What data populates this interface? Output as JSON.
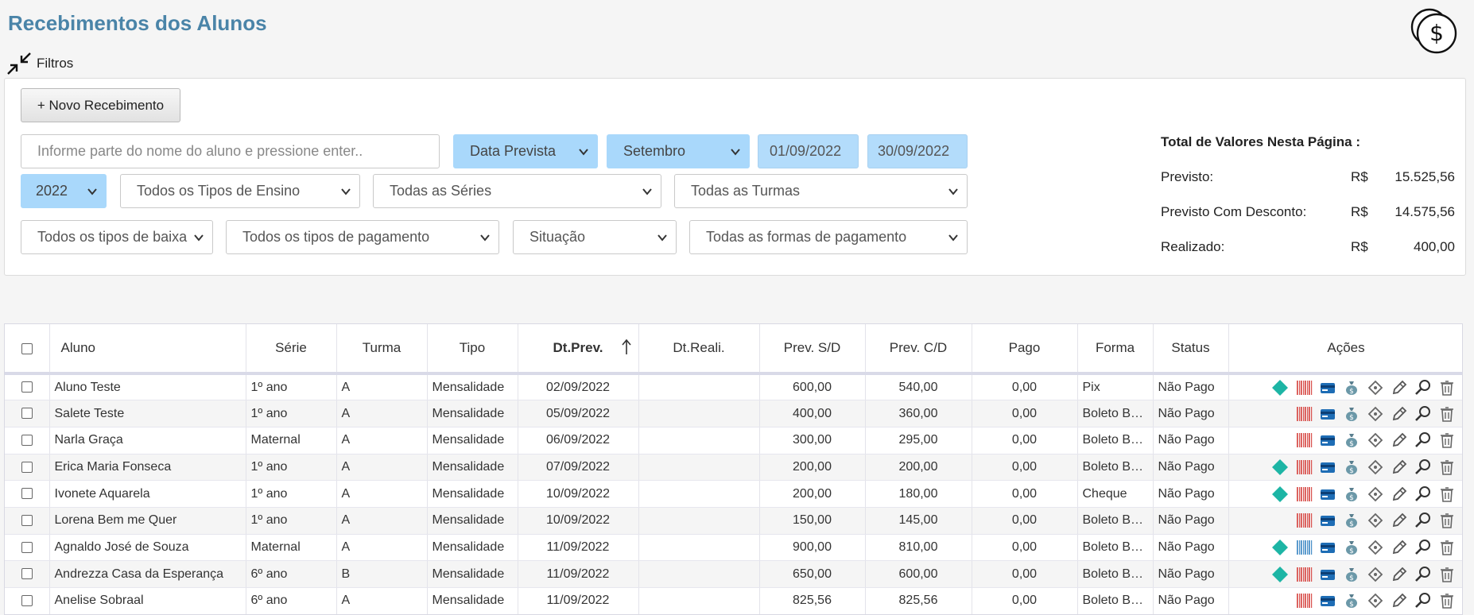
{
  "header": {
    "title": "Recebimentos dos Alunos"
  },
  "filters": {
    "toggle_label": "Filtros",
    "new_button": "+ Novo Recebimento",
    "search_placeholder": "Informe parte do nome do aluno e pressione enter..",
    "date_type": "Data Prevista",
    "month": "Setembro",
    "date_from": "01/09/2022",
    "date_to": "30/09/2022",
    "year": "2022",
    "teaching_type": "Todos os Tipos de Ensino",
    "series": "Todas as Séries",
    "classes": "Todas as Turmas",
    "write_off_type": "Todos os tipos de baixa",
    "payment_type": "Todos os tipos de pagamento",
    "situation": "Situação",
    "payment_form": "Todas as formas de pagamento"
  },
  "totals": {
    "title": "Total de Valores Nesta Página :",
    "currency": "R$",
    "rows": [
      {
        "label": "Previsto:",
        "value": "15.525,56"
      },
      {
        "label": "Previsto Com Desconto:",
        "value": "14.575,56"
      },
      {
        "label": "Realizado:",
        "value": "400,00"
      }
    ]
  },
  "table": {
    "columns": [
      "Aluno",
      "Série",
      "Turma",
      "Tipo",
      "Dt.Prev.",
      "Dt.Reali.",
      "Prev. S/D",
      "Prev. C/D",
      "Pago",
      "Forma",
      "Status",
      "Ações"
    ],
    "rows": [
      {
        "aluno": "Aluno Teste",
        "serie": "1º ano",
        "turma": "A",
        "tipo": "Mensalidade",
        "dt_prev": "02/09/2022",
        "dt_reali": "",
        "prev_sd": "600,00",
        "prev_cd": "540,00",
        "pago": "0,00",
        "forma": "Pix",
        "status": "Não Pago",
        "pix": true,
        "barcode": "red"
      },
      {
        "aluno": "Salete Teste",
        "serie": "1º ano",
        "turma": "A",
        "tipo": "Mensalidade",
        "dt_prev": "05/09/2022",
        "dt_reali": "",
        "prev_sd": "400,00",
        "prev_cd": "360,00",
        "pago": "0,00",
        "forma": "Boleto Bancário",
        "status": "Não Pago",
        "pix": false,
        "barcode": "red"
      },
      {
        "aluno": "Narla Graça",
        "serie": "Maternal",
        "turma": "A",
        "tipo": "Mensalidade",
        "dt_prev": "06/09/2022",
        "dt_reali": "",
        "prev_sd": "300,00",
        "prev_cd": "295,00",
        "pago": "0,00",
        "forma": "Boleto Bancário",
        "status": "Não Pago",
        "pix": false,
        "barcode": "red"
      },
      {
        "aluno": "Erica Maria Fonseca",
        "serie": "1º ano",
        "turma": "A",
        "tipo": "Mensalidade",
        "dt_prev": "07/09/2022",
        "dt_reali": "",
        "prev_sd": "200,00",
        "prev_cd": "200,00",
        "pago": "0,00",
        "forma": "Boleto Bancário",
        "status": "Não Pago",
        "pix": true,
        "barcode": "red"
      },
      {
        "aluno": "Ivonete Aquarela",
        "serie": "1º ano",
        "turma": "A",
        "tipo": "Mensalidade",
        "dt_prev": "10/09/2022",
        "dt_reali": "",
        "prev_sd": "200,00",
        "prev_cd": "180,00",
        "pago": "0,00",
        "forma": "Cheque",
        "status": "Não Pago",
        "pix": true,
        "barcode": "red"
      },
      {
        "aluno": "Lorena Bem me Quer",
        "serie": "1º ano",
        "turma": "A",
        "tipo": "Mensalidade",
        "dt_prev": "10/09/2022",
        "dt_reali": "",
        "prev_sd": "150,00",
        "prev_cd": "145,00",
        "pago": "0,00",
        "forma": "Boleto Bancário",
        "status": "Não Pago",
        "pix": false,
        "barcode": "red"
      },
      {
        "aluno": "Agnaldo José de Souza",
        "serie": "Maternal",
        "turma": "A",
        "tipo": "Mensalidade",
        "dt_prev": "11/09/2022",
        "dt_reali": "",
        "prev_sd": "900,00",
        "prev_cd": "810,00",
        "pago": "0,00",
        "forma": "Boleto Bancário",
        "status": "Não Pago",
        "pix": true,
        "barcode": "blue"
      },
      {
        "aluno": "Andrezza Casa da Esperança",
        "serie": "6º ano",
        "turma": "B",
        "tipo": "Mensalidade",
        "dt_prev": "11/09/2022",
        "dt_reali": "",
        "prev_sd": "650,00",
        "prev_cd": "600,00",
        "pago": "0,00",
        "forma": "Boleto Bancário",
        "status": "Não Pago",
        "pix": true,
        "barcode": "red"
      },
      {
        "aluno": "Anelise Sobraal",
        "serie": "6º ano",
        "turma": "A",
        "tipo": "Mensalidade",
        "dt_prev": "11/09/2022",
        "dt_reali": "",
        "prev_sd": "825,56",
        "prev_cd": "825,56",
        "pago": "0,00",
        "forma": "Boleto Bancário",
        "status": "Não Pago",
        "pix": false,
        "barcode": "red"
      }
    ]
  },
  "colors": {
    "title": "#4a84a8",
    "highlight_field": "#a9d8fb",
    "pix": "#1db5a5",
    "barcode_red": "#d9534f",
    "barcode_blue": "#4a90c8",
    "card": "#1e6db5"
  },
  "icons": [
    "coin-dollar-icon",
    "collapse-arrows-icon",
    "pix-icon",
    "barcode-icon",
    "credit-card-icon",
    "money-bag-icon",
    "ticket-icon",
    "pencil-icon",
    "magnifier-icon",
    "trash-icon"
  ]
}
